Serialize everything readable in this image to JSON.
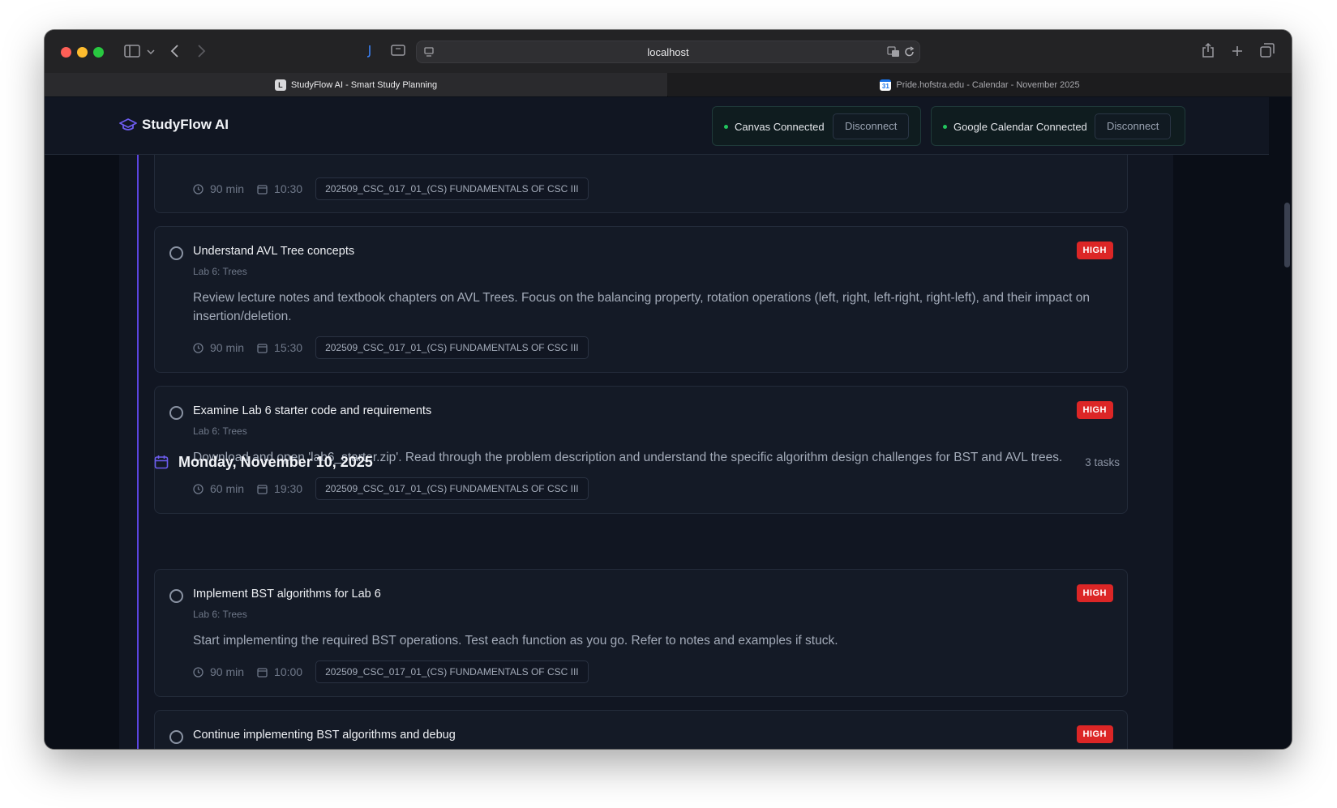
{
  "browser": {
    "address": "localhost",
    "tabs": [
      {
        "label": "StudyFlow AI - Smart Study Planning",
        "favicon": "L"
      },
      {
        "label": "Pride.hofstra.edu - Calendar - November 2025",
        "favicon": "31"
      }
    ]
  },
  "header": {
    "app_name": "StudyFlow AI",
    "connections": [
      {
        "label": "Canvas Connected",
        "button": "Disconnect"
      },
      {
        "label": "Google Calendar Connected",
        "button": "Disconnect"
      }
    ]
  },
  "tasks_above": {
    "meta": {
      "duration": "90 min",
      "time": "10:30",
      "course": "202509_CSC_017_01_(CS) FUNDAMENTALS OF CSC III"
    }
  },
  "task_cards": [
    {
      "title": "Understand AVL Tree concepts",
      "subtitle": "Lab 6: Trees",
      "description": "Review lecture notes and textbook chapters on AVL Trees. Focus on the balancing property, rotation operations (left, right, left-right, right-left), and their impact on insertion/deletion.",
      "priority": "HIGH",
      "duration": "90 min",
      "time": "15:30",
      "course": "202509_CSC_017_01_(CS) FUNDAMENTALS OF CSC III"
    },
    {
      "title": "Examine Lab 6 starter code and requirements",
      "subtitle": "Lab 6: Trees",
      "description": "Download and open 'lab6_starter.zip'. Read through the problem description and understand the specific algorithm design challenges for BST and AVL trees.",
      "priority": "HIGH",
      "duration": "60 min",
      "time": "19:30",
      "course": "202509_CSC_017_01_(CS) FUNDAMENTALS OF CSC III"
    }
  ],
  "day": {
    "title": "Monday, November 10, 2025",
    "count": "3 tasks",
    "tasks": [
      {
        "title": "Implement BST algorithms for Lab 6",
        "subtitle": "Lab 6: Trees",
        "description": "Start implementing the required BST operations. Test each function as you go. Refer to notes and examples if stuck.",
        "priority": "HIGH",
        "duration": "90 min",
        "time": "10:00",
        "course": "202509_CSC_017_01_(CS) FUNDAMENTALS OF CSC III"
      },
      {
        "title": "Continue implementing BST algorithms and debug",
        "priority": "HIGH"
      }
    ]
  }
}
